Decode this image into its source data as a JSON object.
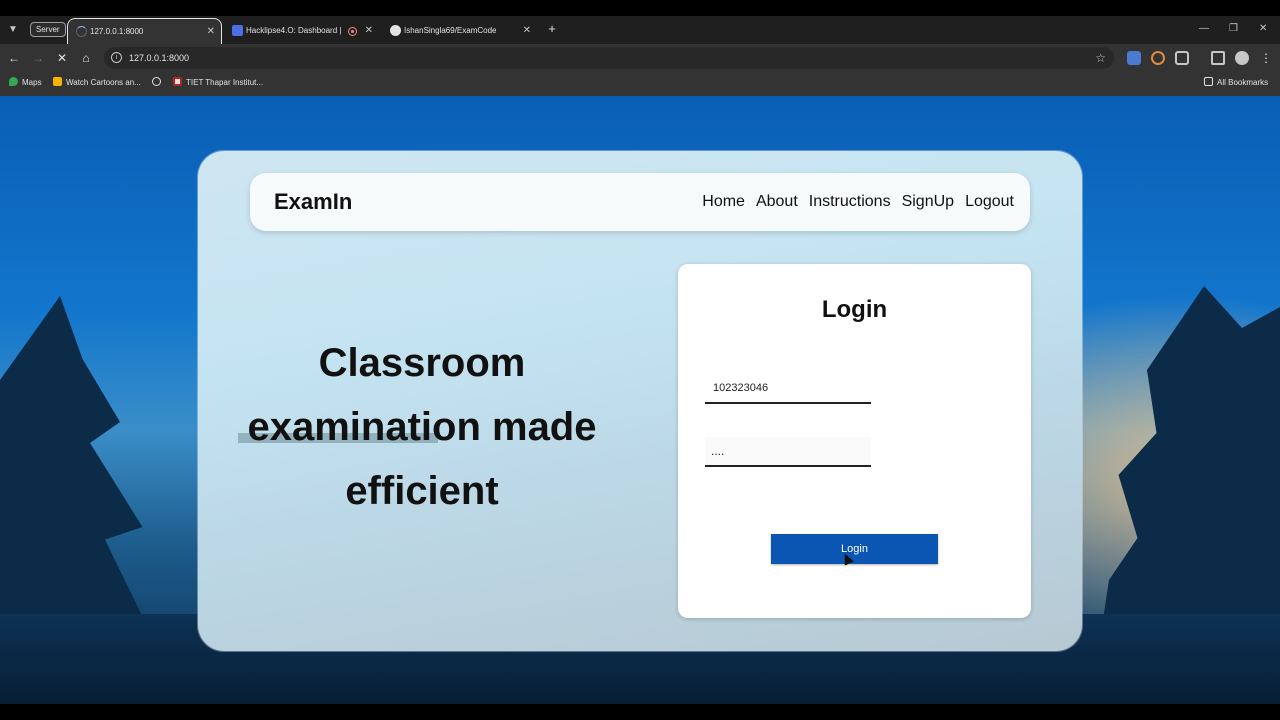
{
  "browser": {
    "server_badge": "Server",
    "tabs": [
      {
        "title": "127.0.0.1:8000",
        "icon": "loading-spinner-icon",
        "active": true
      },
      {
        "title": "Hacklipse4.O: Dashboard | D",
        "icon": "dashboard-favicon-icon",
        "recording": true,
        "active": false
      },
      {
        "title": "IshanSingla69/ExamCode",
        "icon": "github-icon",
        "active": false
      }
    ],
    "new_tab": "+",
    "address": "127.0.0.1:8000",
    "bookmarks": [
      {
        "label": "Maps",
        "icon": "maps-pin-icon"
      },
      {
        "label": "Watch Cartoons an...",
        "icon": "cartoon-favicon-icon"
      },
      {
        "label": "",
        "icon": "globe-icon"
      },
      {
        "label": "TIET Thapar Institut...",
        "icon": "tiet-favicon-icon"
      }
    ],
    "all_bookmarks": "All Bookmarks"
  },
  "navbar": {
    "brand": "ExamIn",
    "links": [
      "Home",
      "About",
      "Instructions",
      "SignUp",
      "Logout"
    ]
  },
  "hero": {
    "line1": "Classroom",
    "line2": "examination made",
    "line3": "efficient"
  },
  "login": {
    "title": "Login",
    "username_value": "102323046",
    "password_value": "....",
    "button_label": "Login"
  },
  "colors": {
    "brand_blue": "#0b55b3",
    "browser_chrome": "#333333",
    "tab_strip": "#1f1f1f"
  }
}
